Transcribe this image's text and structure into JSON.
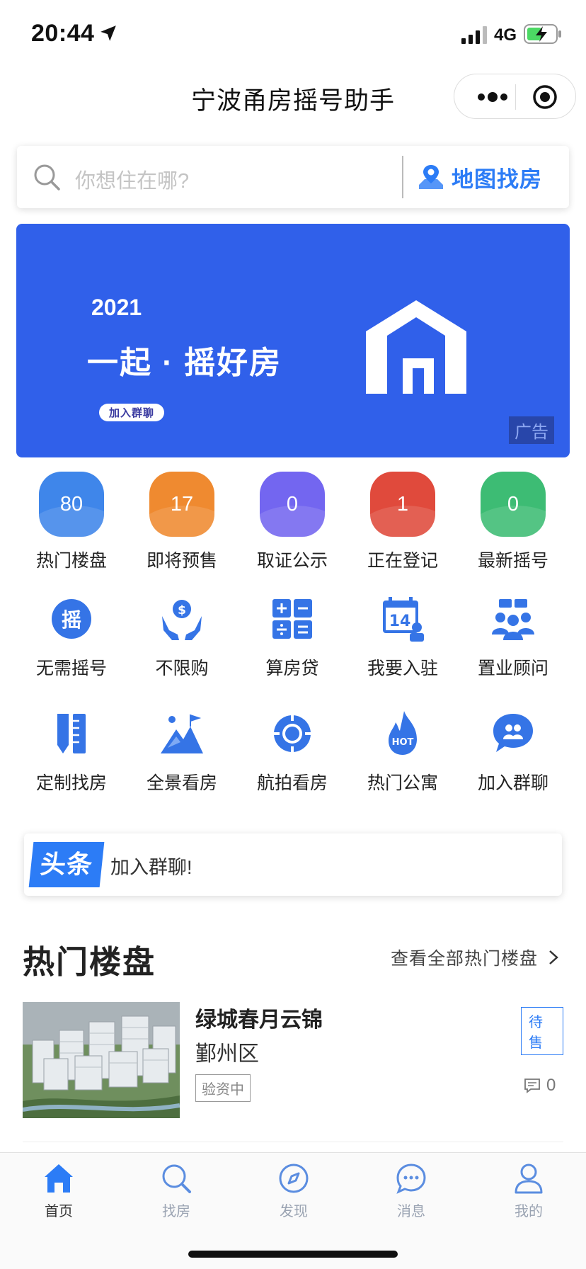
{
  "status_bar": {
    "time": "20:44",
    "network": "4G"
  },
  "nav": {
    "title": "宁波甬房摇号助手"
  },
  "search": {
    "placeholder": "你想住在哪?",
    "map_label": "地图找房"
  },
  "banner": {
    "year": "2021",
    "slogan": "一起 · 摇好房",
    "join_label": "加入群聊",
    "ad_label": "广告",
    "color": "#3060ea"
  },
  "stats": [
    {
      "value": "80",
      "label": "热门楼盘",
      "color": "#3f86ea"
    },
    {
      "value": "17",
      "label": "即将预售",
      "color": "#ef8a30"
    },
    {
      "value": "0",
      "label": "取证公示",
      "color": "#7366f0"
    },
    {
      "value": "1",
      "label": "正在登记",
      "color": "#e04a3c"
    },
    {
      "value": "0",
      "label": "最新摇号",
      "color": "#3dbc74"
    }
  ],
  "grid": [
    {
      "label": "无需摇号",
      "icon": "yao-icon"
    },
    {
      "label": "不限购",
      "icon": "money-hands-icon"
    },
    {
      "label": "算房贷",
      "icon": "calculator-icon"
    },
    {
      "label": "我要入驻",
      "icon": "calendar-14-icon"
    },
    {
      "label": "置业顾问",
      "icon": "consultants-icon"
    },
    {
      "label": "定制找房",
      "icon": "ruler-pencil-icon"
    },
    {
      "label": "全景看房",
      "icon": "mountain-flag-icon"
    },
    {
      "label": "航拍看房",
      "icon": "globe-lifebuoy-icon"
    },
    {
      "label": "热门公寓",
      "icon": "hot-flame-icon"
    },
    {
      "label": "加入群聊",
      "icon": "chat-group-icon"
    }
  ],
  "headline": {
    "tag": "头条",
    "text": "加入群聊!"
  },
  "section": {
    "title": "热门楼盘",
    "more_label": "查看全部热门楼盘"
  },
  "listings": [
    {
      "name": "绿城春月云锦",
      "district": "鄞州区",
      "capital_status": "验资中",
      "sale_status": "待售",
      "comments": "0"
    }
  ],
  "tabbar": [
    {
      "label": "首页",
      "icon": "home-icon",
      "active": true
    },
    {
      "label": "找房",
      "icon": "search-tab-icon",
      "active": false
    },
    {
      "label": "发现",
      "icon": "compass-icon",
      "active": false
    },
    {
      "label": "消息",
      "icon": "message-icon",
      "active": false
    },
    {
      "label": "我的",
      "icon": "user-icon",
      "active": false
    }
  ],
  "colors": {
    "accent": "#2c7cf6",
    "icon_blue": "#3574e6"
  }
}
